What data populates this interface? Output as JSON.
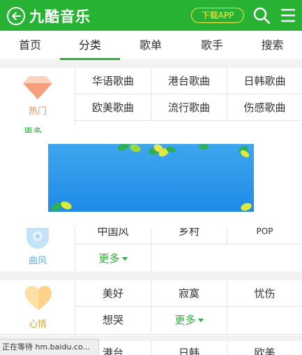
{
  "header": {
    "brand": "九酷音乐",
    "download_label": "下载APP",
    "background": "#27b234",
    "accent": "#ffe94a"
  },
  "tabs": [
    {
      "label": "首页"
    },
    {
      "label": "分类",
      "active": true
    },
    {
      "label": "歌单"
    },
    {
      "label": "歌手"
    },
    {
      "label": "搜索"
    }
  ],
  "categories": {
    "hot": {
      "name": "热门",
      "icon": "diamond-icon",
      "items": [
        "华语歌曲",
        "港台歌曲",
        "日韩歌曲",
        "欧美歌曲",
        "流行歌曲",
        "伤感歌曲"
      ],
      "cut_text": "更多"
    },
    "style": {
      "name": "曲风",
      "icon": "cd-icon",
      "items": [
        "中国风",
        "乡村",
        "POP"
      ],
      "more": "更多"
    },
    "mood": {
      "name": "心情",
      "icon": "heart-icon",
      "items": [
        "美好",
        "寂寞",
        "忧伤",
        "想哭"
      ],
      "more": "更多"
    },
    "region": {
      "items": [
        "港台",
        "日韩",
        "欧美"
      ]
    }
  },
  "status_bar": {
    "text": "正在等待 hm.baidu.co..."
  }
}
